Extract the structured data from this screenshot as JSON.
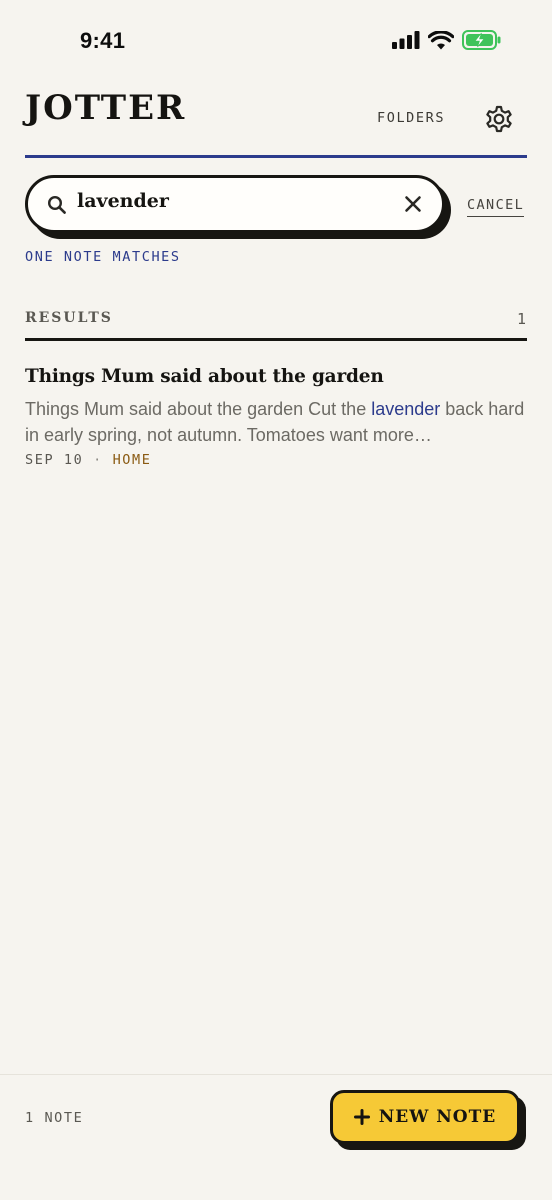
{
  "status_bar": {
    "time": "9:41",
    "icons": [
      "signal-icon",
      "wifi-icon",
      "battery-charging-icon"
    ]
  },
  "header": {
    "title": "JOTTER",
    "folders_label": "FOLDERS",
    "settings_icon": "gear-icon"
  },
  "search": {
    "value": "lavender",
    "cancel_label": "CANCEL",
    "match_text": "ONE NOTE MATCHES"
  },
  "results": {
    "label": "RESULTS",
    "count": "1",
    "notes": [
      {
        "title": "Things Mum said about the garden",
        "snippet_before": "Things Mum said about the garden Cut the ",
        "snippet_highlight": "lavender",
        "snippet_after": " back hard in early spring, not autumn. Tomatoes want more…",
        "date": "SEP 10",
        "separator": "·",
        "folder": "HOME"
      }
    ]
  },
  "footer": {
    "note_count": "1 NOTE",
    "new_note_label": "NEW NOTE"
  },
  "colors": {
    "background": "#f6f4ef",
    "accent_blue": "#2c3b8c",
    "button_yellow": "#f6c936",
    "folder_brown": "#8a5a12",
    "battery_green": "#3fc35a"
  }
}
